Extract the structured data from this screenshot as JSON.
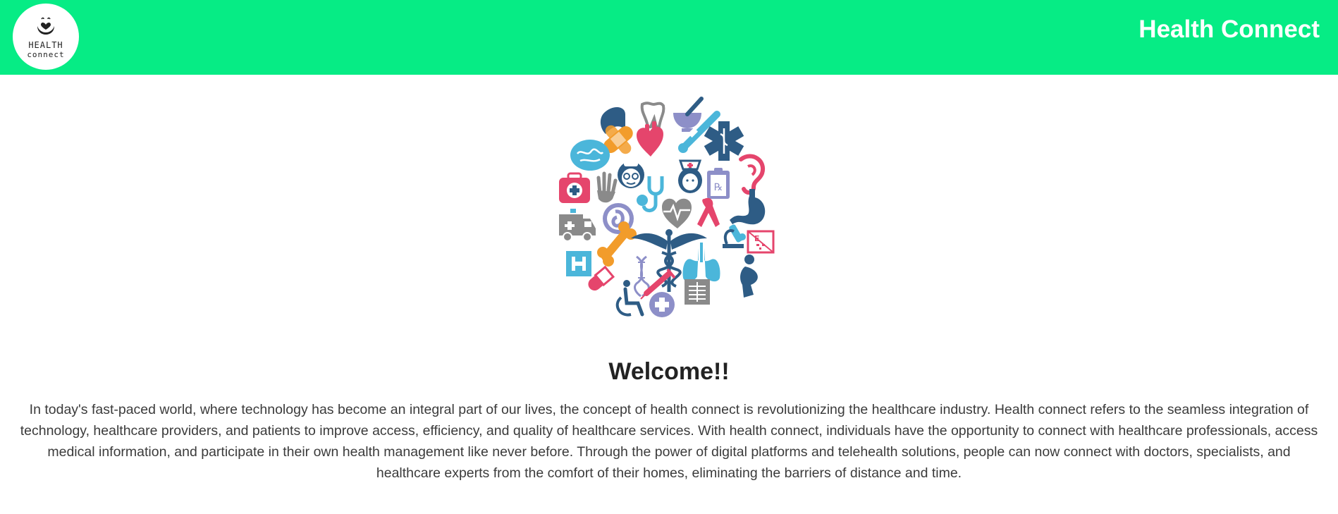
{
  "header": {
    "logo": {
      "line1": "HEALTH",
      "line2": "connect"
    },
    "title": "Health Connect",
    "background_color": "#06ec85"
  },
  "hero": {
    "icons": [
      "liver-icon",
      "tooth-icon",
      "mortar-pestle-icon",
      "thermometer-icon",
      "bandage-icon",
      "heart-icon",
      "star-of-life-icon",
      "brain-icon",
      "doctor-icon",
      "stethoscope-icon",
      "nurse-icon",
      "prescription-clipboard-icon",
      "ear-icon",
      "first-aid-kit-icon",
      "hand-icon",
      "fetus-icon",
      "heartbeat-icon",
      "awareness-ribbon-icon",
      "stomach-icon",
      "ambulance-icon",
      "bone-icon",
      "caduceus-icon",
      "microscope-icon",
      "eye-chart-icon",
      "hospital-icon",
      "dna-icon",
      "lungs-icon",
      "pregnant-woman-icon",
      "pill-icon",
      "syringe-icon",
      "wheelchair-icon",
      "medical-cross-icon",
      "xray-icon"
    ],
    "colors": {
      "navy": "#2e5c85",
      "blue": "#4bb6da",
      "red": "#e5456c",
      "orange": "#f29c2b",
      "grey": "#8a8a8a",
      "purple": "#8d8fc8"
    }
  },
  "main": {
    "heading": "Welcome!!",
    "paragraph": "In today's fast-paced world, where technology has become an integral part of our lives, the concept of health connect is revolutionizing the healthcare industry. Health connect refers to the seamless integration of technology, healthcare providers, and patients to improve access, efficiency, and quality of healthcare services. With health connect, individuals have the opportunity to connect with healthcare professionals, access medical information, and participate in their own health management like never before. Through the power of digital platforms and telehealth solutions, people can now connect with doctors, specialists, and healthcare experts from the comfort of their homes, eliminating the barriers of distance and time."
  }
}
